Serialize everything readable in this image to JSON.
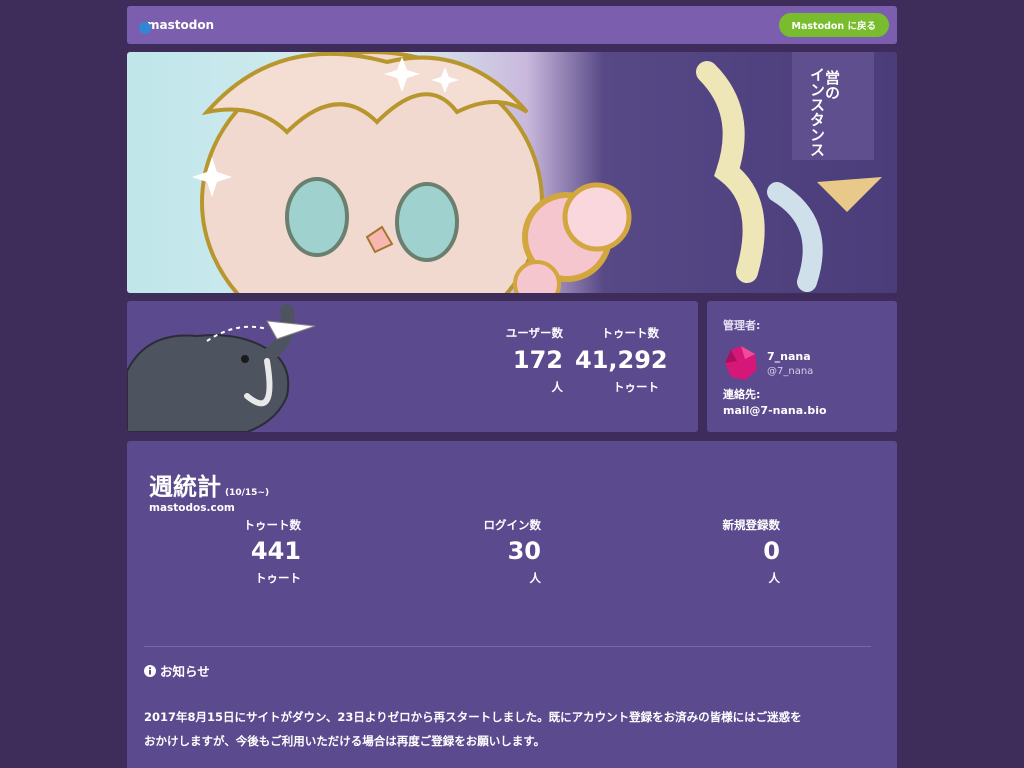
{
  "header": {
    "logo_text": "mastodon",
    "back_button": "Mastodon に戻る"
  },
  "banner": {
    "title_vertical_1": "営の",
    "title_vertical_2": "インスタンス"
  },
  "stats": {
    "users_label": "ユーザー数",
    "users_value": "172",
    "users_unit": "人",
    "toots_label": "トゥート数",
    "toots_value": "41,292",
    "toots_unit": "トゥート"
  },
  "admin": {
    "label": "管理者:",
    "name": "7_nana",
    "handle": "@7_nana",
    "contact_label": "連絡先:",
    "contact_email": "mail@7-nana.bio"
  },
  "weekly": {
    "title": "週統計",
    "range": "(10/15~)",
    "host": "mastodos.com",
    "columns": [
      {
        "label": "トゥート数",
        "value": "441",
        "unit": "トゥート"
      },
      {
        "label": "ログイン数",
        "value": "30",
        "unit": "人"
      },
      {
        "label": "新規登録数",
        "value": "0",
        "unit": "人"
      }
    ]
  },
  "notice": {
    "heading": "お知らせ",
    "line1": "2017年8月15日にサイトがダウン、23日よりゼロから再スタートしました。既にアカウント登録をお済みの皆様にはご迷惑を",
    "line2": "おかけしますが、今後もご利用いただける場合は再度ご登録をお願いします。"
  },
  "colors": {
    "page_bg": "#3e2d5b",
    "card_bg": "#5c4a8e",
    "topbar_bg": "#7b5fae",
    "button_green": "#79bd2e",
    "avatar_magenta": "#d6177a"
  },
  "icons": [
    "mastodon-logo-icon",
    "mascot-elephant-illustration",
    "admin-avatar-icon",
    "info-circle-icon"
  ]
}
